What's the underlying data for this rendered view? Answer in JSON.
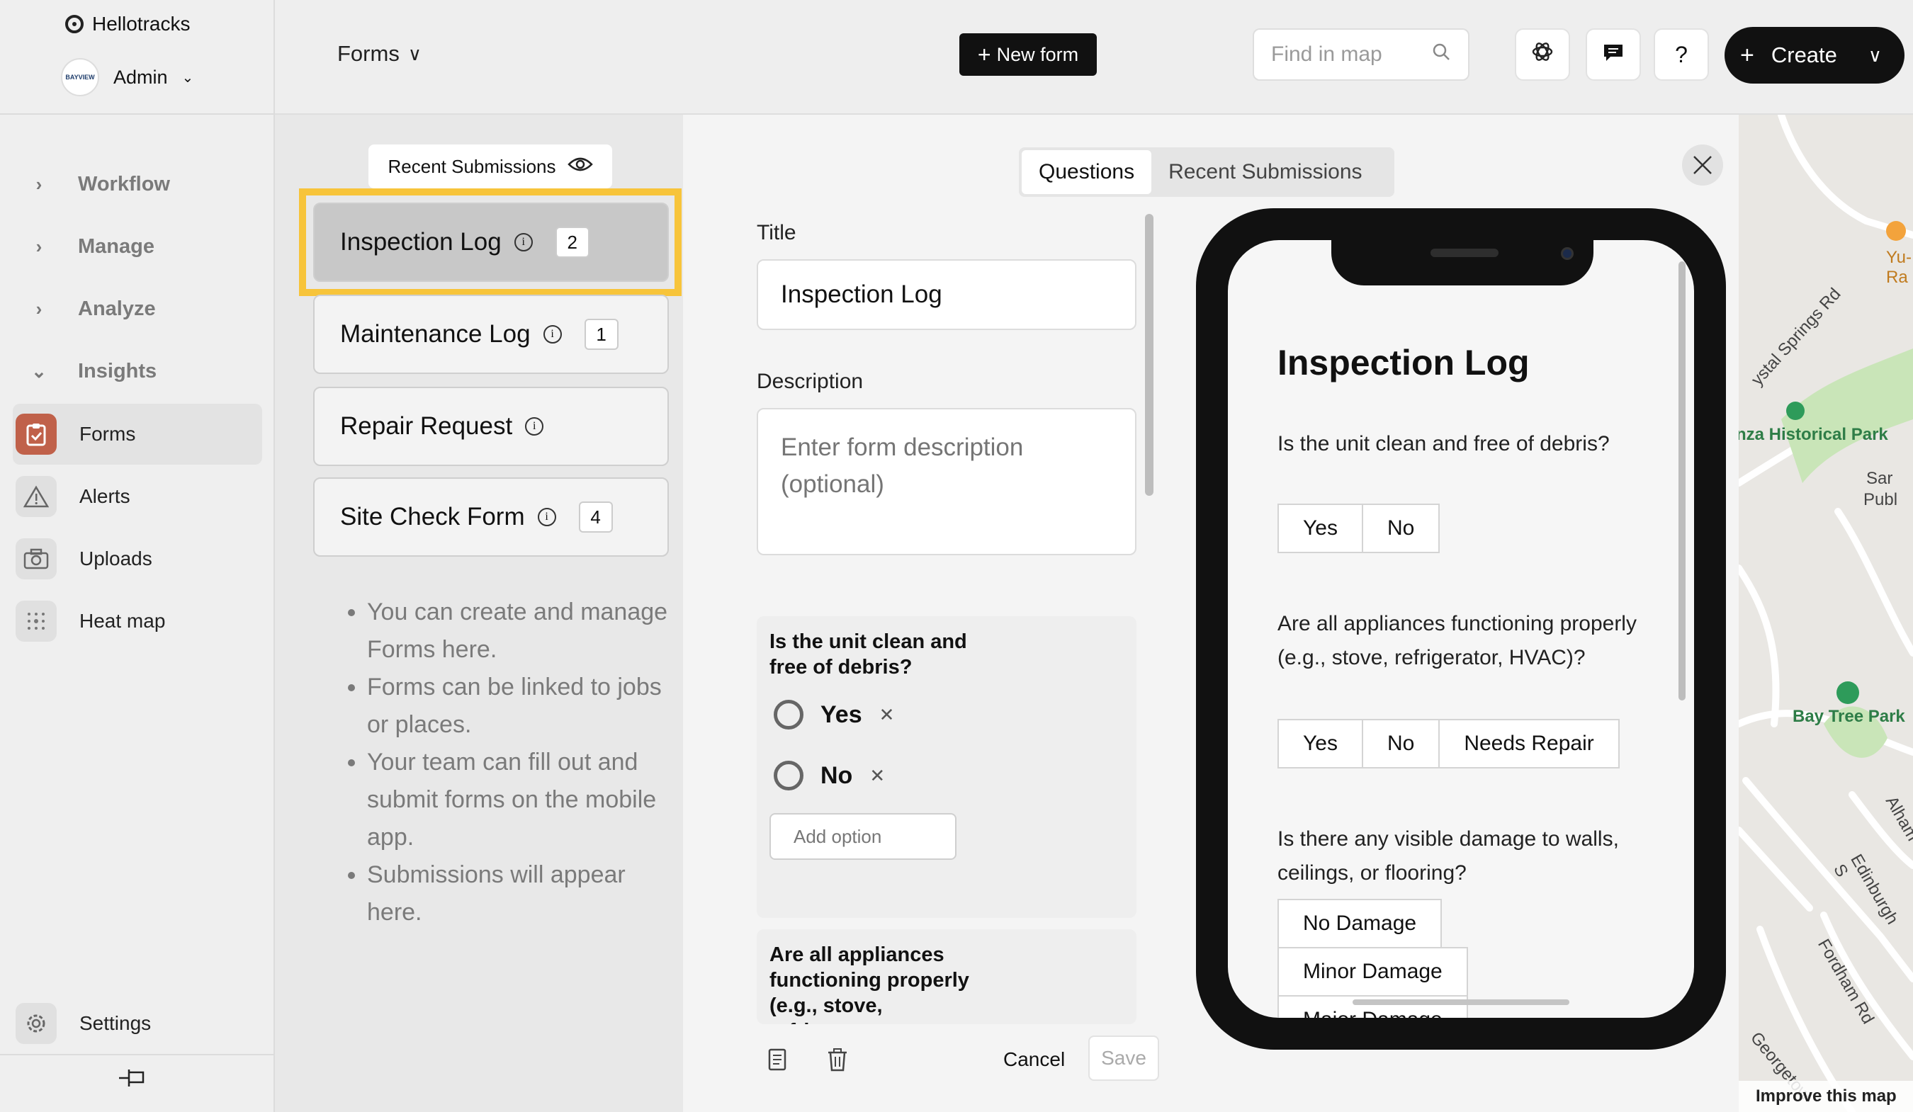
{
  "app": {
    "brand": "Hellotracks"
  },
  "user": {
    "name": "Admin",
    "avatar_text": "BAYVIEW"
  },
  "sidebar": {
    "groups": [
      {
        "label": "Workflow",
        "expanded": false
      },
      {
        "label": "Manage",
        "expanded": false
      },
      {
        "label": "Analyze",
        "expanded": false
      },
      {
        "label": "Insights",
        "expanded": true
      }
    ],
    "items": [
      {
        "label": "Forms",
        "icon": "clipboard-icon",
        "active": true
      },
      {
        "label": "Alerts",
        "icon": "warning-icon"
      },
      {
        "label": "Uploads",
        "icon": "camera-icon"
      },
      {
        "label": "Heat map",
        "icon": "heatmap-icon"
      }
    ],
    "settings_label": "Settings"
  },
  "header": {
    "forms_dropdown": "Forms",
    "new_form_label": "New form",
    "search_placeholder": "Find in map",
    "help_label": "?",
    "create_label": "Create"
  },
  "formlist": {
    "recent_submissions_label": "Recent Submissions",
    "forms": [
      {
        "name": "Inspection Log",
        "count": "2",
        "selected": true
      },
      {
        "name": "Maintenance Log",
        "count": "1"
      },
      {
        "name": "Repair Request",
        "count": ""
      },
      {
        "name": "Site Check Form",
        "count": "4"
      }
    ],
    "tips": [
      "You can create and manage Forms here.",
      "Forms can be linked to jobs or places.",
      "Your team can fill out and submit forms on the mobile app.",
      "Submissions will appear here."
    ]
  },
  "editor": {
    "tabs": [
      "Questions",
      "Recent Submissions"
    ],
    "title_label": "Title",
    "title_value": "Inspection Log",
    "description_label": "Description",
    "description_placeholder": "Enter form description (optional)",
    "questions": [
      {
        "text": "Is the unit clean and free of debris?",
        "options": [
          "Yes",
          "No"
        ]
      },
      {
        "text": "Are all appliances functioning properly (e.g., stove, refrigerator,"
      }
    ],
    "add_option_placeholder": "Add option",
    "cancel_label": "Cancel",
    "save_label": "Save"
  },
  "preview": {
    "title": "Inspection Log",
    "questions": [
      {
        "text": "Is the unit clean and free of debris?",
        "options": [
          "Yes",
          "No"
        ]
      },
      {
        "text": "Are all appliances functioning properly (e.g., stove, refrigerator, HVAC)?",
        "options": [
          "Yes",
          "No",
          "Needs Repair"
        ]
      },
      {
        "text": "Is there any visible damage to walls, ceilings, or flooring?",
        "options": [
          "No Damage",
          "Minor Damage",
          "Major Damage"
        ]
      }
    ]
  },
  "map": {
    "labels": [
      "Yu-Ra",
      "ystal Springs Rd",
      "nza Historical Park",
      "Sar",
      "Publ",
      "Bay Tree Park",
      "Alham",
      "Edinburgh S",
      "Fordham Rd",
      "Georgetow"
    ],
    "improve_label": "Improve this map"
  }
}
